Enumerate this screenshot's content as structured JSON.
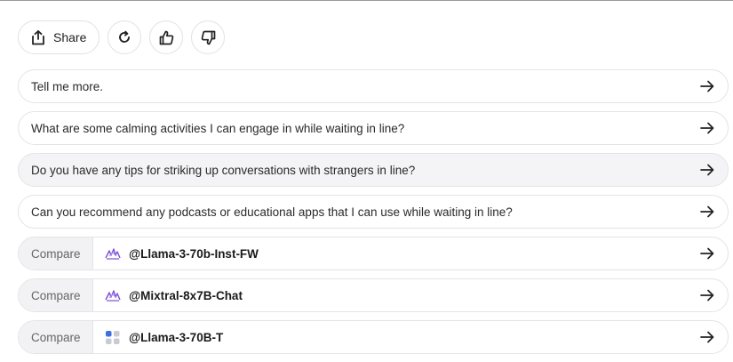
{
  "toolbar": {
    "share_label": "Share",
    "icons": [
      "share-icon",
      "refresh-icon",
      "thumbs-up-icon",
      "thumbs-down-icon"
    ]
  },
  "suggestions": [
    {
      "text": "Tell me more."
    },
    {
      "text": "What are some calming activities I can engage in while waiting in line?"
    },
    {
      "text": "Do you have any tips for striking up conversations with strangers in line?"
    },
    {
      "text": "Can you recommend any podcasts or educational apps that I can use while waiting in line?"
    }
  ],
  "compare": [
    {
      "label": "Compare",
      "bot": "@Llama-3-70b-Inst-FW",
      "icon": "meta-purple-icon"
    },
    {
      "label": "Compare",
      "bot": "@Mixtral-8x7B-Chat",
      "icon": "meta-purple-icon"
    },
    {
      "label": "Compare",
      "bot": "@Llama-3-70B-T",
      "icon": "dots-grid-icon"
    }
  ],
  "colors": {
    "accent_purple": "#7b4fd6",
    "border": "#e4e4e4",
    "hover_bg": "#f4f4f6",
    "dot_blue": "#3d6fe0",
    "dot_grey": "#c8cbd2"
  }
}
